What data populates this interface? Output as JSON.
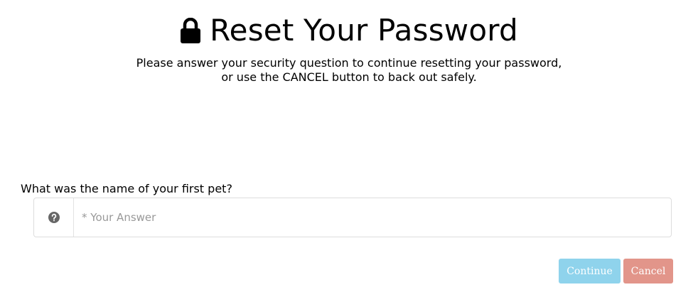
{
  "header": {
    "icon": "lock-icon",
    "title": "Reset Your Password",
    "instructions_line1": "Please answer your security question to continue resetting your password,",
    "instructions_line2": "or use the CANCEL button to back out safely."
  },
  "security_question": {
    "label": "What was the name of your first pet?",
    "help_icon": "question-circle-icon",
    "answer_value": "",
    "answer_placeholder": "* Your Answer"
  },
  "actions": {
    "continue_label": "Continue",
    "cancel_label": "Cancel"
  },
  "colors": {
    "continue_button": "#8fd3ec",
    "cancel_button": "#e2958a",
    "input_border": "#dddddd",
    "help_icon": "#666666"
  }
}
